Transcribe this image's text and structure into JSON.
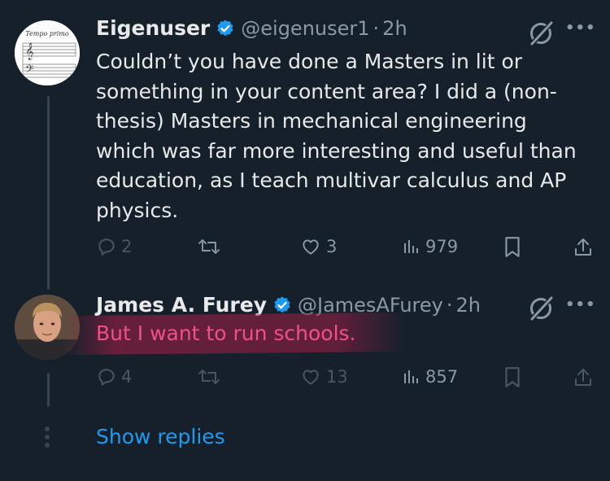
{
  "tweet1": {
    "name": "Eigenuser",
    "handle": "@eigenuser1",
    "separator": "·",
    "time": "2h",
    "avatar_text": "Tempo primo",
    "body_lines": [
      "Couldn’t you have done a Masters in lit or",
      "something in your content area? I did a (non-",
      "thesis) Masters in mechanical engineering",
      "which was far more interesting and useful than",
      "education, as I teach multivar calculus and AP",
      "physics."
    ],
    "replies": "2",
    "likes": "3",
    "views": "979",
    "more": "•••"
  },
  "tweet2": {
    "name": "James A. Furey",
    "handle": "@JamesAFurey",
    "separator": "·",
    "time": "2h",
    "body": "But I want to run schools.",
    "replies": "4",
    "likes": "13",
    "views": "857",
    "more": "•••"
  },
  "show_replies": "Show replies",
  "colors": {
    "background": "#15202b",
    "text": "#e7e9ea",
    "muted": "#8b98a5",
    "accent": "#1d9bf0",
    "highlight_text": "#f0508a"
  },
  "icons": [
    "verified-badge-icon",
    "grok-icon",
    "more-icon",
    "reply-icon",
    "retweet-icon",
    "like-icon",
    "views-icon",
    "bookmark-icon",
    "share-icon"
  ]
}
